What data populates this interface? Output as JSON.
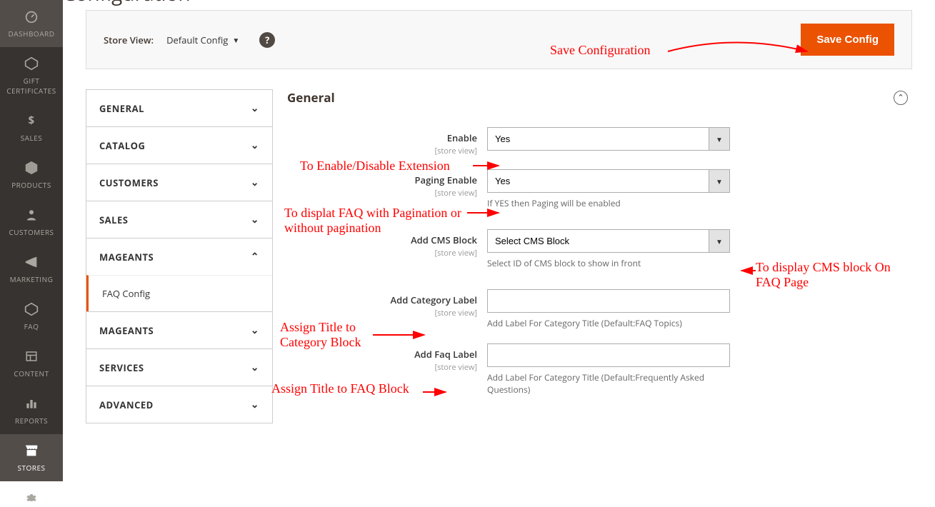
{
  "page_title": "Configuration",
  "sidebar": {
    "items": [
      {
        "label": "DASHBOARD"
      },
      {
        "label": "GIFT CERTIFICATES"
      },
      {
        "label": "SALES"
      },
      {
        "label": "PRODUCTS"
      },
      {
        "label": "CUSTOMERS"
      },
      {
        "label": "MARKETING"
      },
      {
        "label": "FAQ"
      },
      {
        "label": "CONTENT"
      },
      {
        "label": "REPORTS"
      },
      {
        "label": "STORES"
      }
    ]
  },
  "toolbar": {
    "store_view_label": "Store View:",
    "store_view_value": "Default Config",
    "save_label": "Save Config"
  },
  "config_nav": {
    "sections": [
      {
        "label": "GENERAL",
        "open": false
      },
      {
        "label": "CATALOG",
        "open": false
      },
      {
        "label": "CUSTOMERS",
        "open": false
      },
      {
        "label": "SALES",
        "open": false
      },
      {
        "label": "MAGEANTS",
        "open": true,
        "items": [
          {
            "label": "FAQ Config",
            "active": true
          }
        ]
      },
      {
        "label": "MAGEANTS",
        "open": false
      },
      {
        "label": "SERVICES",
        "open": false
      },
      {
        "label": "ADVANCED",
        "open": false
      }
    ]
  },
  "settings": {
    "section_title": "General",
    "fields": {
      "enable": {
        "label": "Enable",
        "scope": "[store view]",
        "value": "Yes"
      },
      "paging": {
        "label": "Paging Enable",
        "scope": "[store view]",
        "value": "Yes",
        "note": "If YES then Paging will be enabled"
      },
      "cms": {
        "label": "Add CMS Block",
        "scope": "[store view]",
        "value": "Select CMS Block",
        "note": "Select ID of CMS block to show in front"
      },
      "cat_label": {
        "label": "Add Category Label",
        "scope": "[store view]",
        "value": "",
        "note": "Add Label For Category Title (Default:FAQ Topics)"
      },
      "faq_label": {
        "label": "Add Faq Label",
        "scope": "[store view]",
        "value": "",
        "note": "Add Label For Category Title (Default:Frequently Asked Questions)"
      }
    }
  },
  "annotations": {
    "save": "Save Configuration",
    "enable": "To Enable/Disable Extension",
    "paging": "To displat FAQ with Pagination or without pagination",
    "cms": "To display CMS block On FAQ Page",
    "cat": "Assign Title to Category Block",
    "faq": "Assign Title to FAQ Block"
  }
}
